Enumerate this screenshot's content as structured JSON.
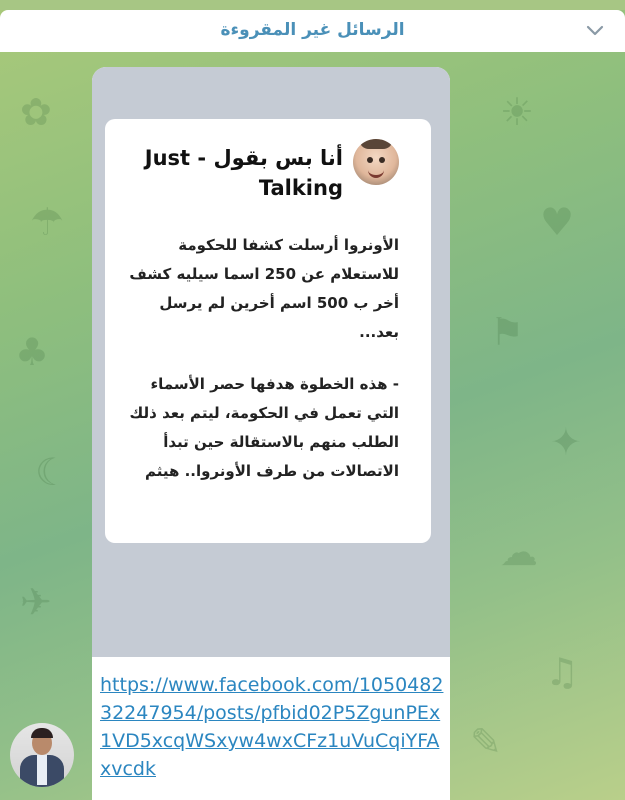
{
  "header": {
    "title": "الرسائل غير المقروءة",
    "collapse_icon": "chevron-down-icon"
  },
  "message": {
    "preview_card": {
      "page_name": "أنا بس بقول - Just Talking",
      "paragraphs": [
        "الأونروا أرسلت كشفا للحكومة للاستعلام عن 250 اسما سيليه كشف أخر ب 500 اسم أخرين لم يرسل بعد...",
        "- هذه الخطوة هدفها حصر الأسماء التي تعمل في الحكومة، ليتم بعد ذلك الطلب منهم بالاستقالة حين تبدأ الاتصالات من طرف الأونروا.. هيثم"
      ]
    },
    "link": "https://www.facebook.com/105048232247954/posts/pfbid02P5ZgunPEx1VD5xcqWSxyw4wxCFz1uVuCqiYFAxvcdk"
  },
  "colors": {
    "accent": "#4a90b8",
    "link": "#2b86c0",
    "chat_background": "#8fbf7d",
    "preview_background": "#c5cbd4"
  }
}
